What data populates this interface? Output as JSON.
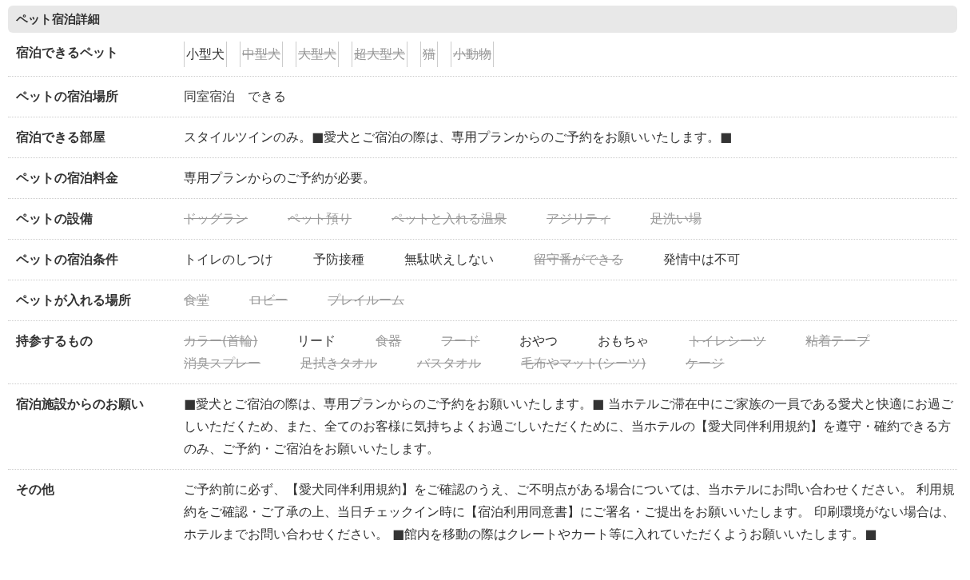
{
  "section": {
    "title": "ペット宿泊詳細"
  },
  "rows": [
    {
      "label": "宿泊できるペット",
      "kind": "boxed_tags",
      "items": [
        {
          "text": "小型犬",
          "available": true
        },
        {
          "text": "中型犬",
          "available": false
        },
        {
          "text": "大型犬",
          "available": false
        },
        {
          "text": "超大型犬",
          "available": false
        },
        {
          "text": "猫",
          "available": false
        },
        {
          "text": "小動物",
          "available": false
        }
      ]
    },
    {
      "label": "ペットの宿泊場所",
      "kind": "text",
      "text": "同室宿泊　できる"
    },
    {
      "label": "宿泊できる部屋",
      "kind": "text",
      "text": "スタイルツインのみ。■愛犬とご宿泊の際は、専用プランからのご予約をお願いいたします。■"
    },
    {
      "label": "ペットの宿泊料金",
      "kind": "text",
      "text": "専用プランからのご予約が必要。"
    },
    {
      "label": "ペットの設備",
      "kind": "tags",
      "items": [
        {
          "text": "ドッグラン",
          "available": false
        },
        {
          "text": "ペット預り",
          "available": false
        },
        {
          "text": "ペットと入れる温泉",
          "available": false
        },
        {
          "text": "アジリティ",
          "available": false
        },
        {
          "text": "足洗い場",
          "available": false
        }
      ]
    },
    {
      "label": "ペットの宿泊条件",
      "kind": "tags",
      "items": [
        {
          "text": "トイレのしつけ",
          "available": true
        },
        {
          "text": "予防接種",
          "available": true
        },
        {
          "text": "無駄吠えしない",
          "available": true
        },
        {
          "text": "留守番ができる",
          "available": false
        },
        {
          "text": "発情中は不可",
          "available": true
        }
      ]
    },
    {
      "label": "ペットが入れる場所",
      "kind": "tags",
      "items": [
        {
          "text": "食堂",
          "available": false
        },
        {
          "text": "ロビー",
          "available": false
        },
        {
          "text": "プレイルーム",
          "available": false
        }
      ]
    },
    {
      "label": "持参するもの",
      "kind": "tags",
      "items": [
        {
          "text": "カラー(首輪)",
          "available": false
        },
        {
          "text": "リード",
          "available": true
        },
        {
          "text": "食器",
          "available": false
        },
        {
          "text": "フード",
          "available": false
        },
        {
          "text": "おやつ",
          "available": true
        },
        {
          "text": "おもちゃ",
          "available": true
        },
        {
          "text": "トイレシーツ",
          "available": false
        },
        {
          "text": "粘着テープ",
          "available": false
        },
        {
          "text": "消臭スプレー",
          "available": false
        },
        {
          "text": "足拭きタオル",
          "available": false
        },
        {
          "text": "バスタオル",
          "available": false
        },
        {
          "text": "毛布やマット(シーツ)",
          "available": false
        },
        {
          "text": "ケージ",
          "available": false
        }
      ]
    },
    {
      "label": "宿泊施設からのお願い",
      "kind": "text",
      "text": "■愛犬とご宿泊の際は、専用プランからのご予約をお願いいたします。■ 当ホテルご滞在中にご家族の一員である愛犬と快適にお過ごしいただくため、また、全てのお客様に気持ちよくお過ごしいただくために、当ホテルの【愛犬同伴利用規約】を遵守・確約できる方のみ、ご予約・ご宿泊をお願いいたします。"
    },
    {
      "label": "その他",
      "kind": "text",
      "text": "ご予約前に必ず、【愛犬同伴利用規約】をご確認のうえ、ご不明点がある場合については、当ホテルにお問い合わせください。 利用規約をご確認・ご了承の上、当日チェックイン時に【宿泊利用同意書】にご署名・ご提出をお願いいたします。 印刷環境がない場合は、ホテルまでお問い合わせください。 ■館内を移動の際はクレートやカート等に入れていただくようお願いいたします。■"
    }
  ]
}
